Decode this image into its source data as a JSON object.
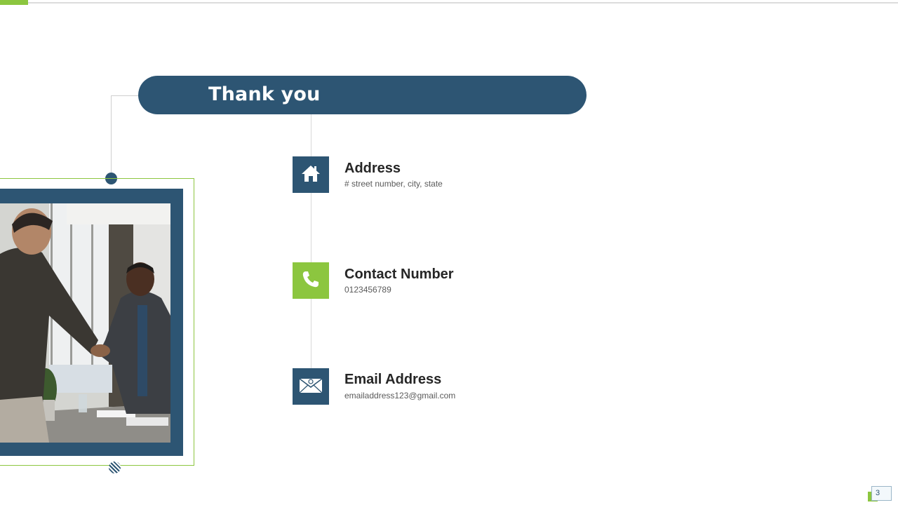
{
  "slide": {
    "title": "Thank you",
    "page_number": "3"
  },
  "contacts": [
    {
      "title": "Address",
      "detail": "# street number, city, state",
      "icon": "house-icon"
    },
    {
      "title": "Contact Number",
      "detail": "0123456789",
      "icon": "phone-icon"
    },
    {
      "title": "Email Address",
      "detail": "emailaddress123@gmail.com",
      "icon": "email-envelope-icon"
    }
  ],
  "image": {
    "subject": "handshake-photo"
  },
  "colors": {
    "primary": "#2d5573",
    "accent": "#8cc63f",
    "text": "#262626"
  }
}
